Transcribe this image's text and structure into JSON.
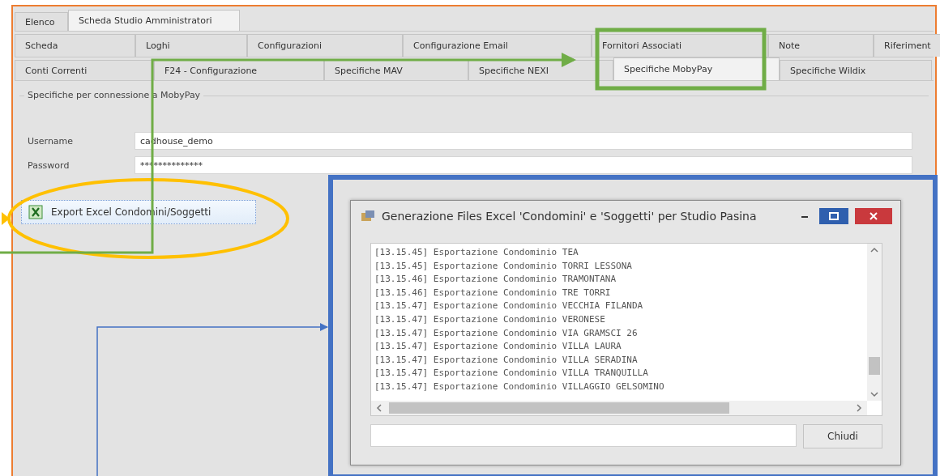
{
  "main_tabs": [
    {
      "label": "Elenco",
      "selected": false
    },
    {
      "label": "Scheda Studio Amministratori",
      "selected": true
    }
  ],
  "sub_tab_rows": [
    [
      {
        "label": "Scheda",
        "selected": false
      },
      {
        "label": "Loghi",
        "selected": false
      },
      {
        "label": "Configurazioni",
        "selected": false
      },
      {
        "label": "Configurazione Email",
        "selected": false
      },
      {
        "label": "Fornitori Associati",
        "selected": false
      },
      {
        "label": "Note",
        "selected": false
      },
      {
        "label": "Riferiment",
        "selected": false
      }
    ],
    [
      {
        "label": "Conti Correnti",
        "selected": false
      },
      {
        "label": "F24 - Configurazione",
        "selected": false
      },
      {
        "label": "Specifiche MAV",
        "selected": false
      },
      {
        "label": "Specifiche NEXI",
        "selected": false
      },
      {
        "label": "Specifiche MobyPay",
        "selected": true
      },
      {
        "label": "Specifiche Wildix",
        "selected": false
      }
    ]
  ],
  "group_box": {
    "title": "Specifiche per connessione a MobyPay",
    "fields": [
      {
        "label": "Username",
        "value": "cadhouse_demo"
      },
      {
        "label": "Password",
        "value": "**************"
      }
    ]
  },
  "export_button": {
    "label": "Export Excel Condomini/Soggetti"
  },
  "dialog": {
    "title": "Generazione Files Excel 'Condomini' e 'Soggetti' per Studio Pasina",
    "log_lines": [
      "[13.15.45] Esportazione Condominio TEA",
      "[13.15.45] Esportazione Condominio TORRI LESSONA",
      "[13.15.46] Esportazione Condominio TRAMONTANA",
      "[13.15.46] Esportazione Condominio TRE TORRI",
      "[13.15.47] Esportazione Condominio VECCHIA FILANDA",
      "[13.15.47] Esportazione Condominio VERONESE",
      "[13.15.47] Esportazione Condominio VIA GRAMSCI 26",
      "[13.15.47] Esportazione Condominio VILLA LAURA",
      "[13.15.47] Esportazione Condominio VILLA SERADINA",
      "[13.15.47] Esportazione Condominio VILLA TRANQUILLA",
      "[13.15.47] Esportazione Condominio VILLAGGIO GELSOMINO"
    ],
    "close_button": "Chiudi"
  }
}
